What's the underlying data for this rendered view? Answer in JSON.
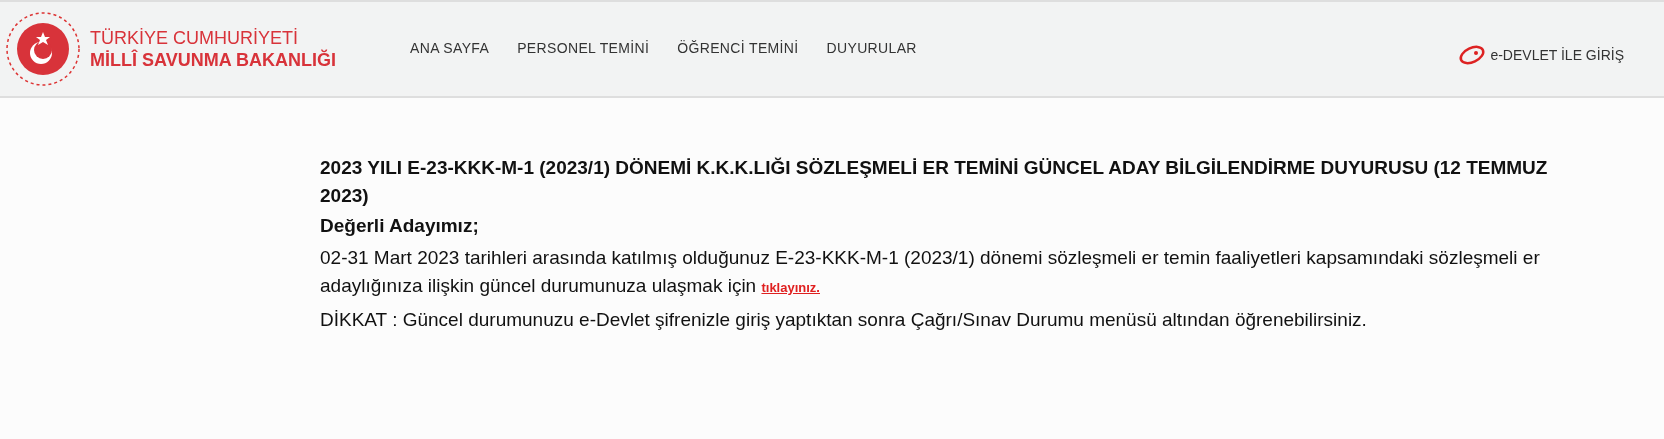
{
  "header": {
    "logo": {
      "line_1": "TÜRKİYE CUMHURİYETİ",
      "line_2": "MİLLÎ SAVUNMA BAKANLIĞI"
    },
    "nav": [
      {
        "label": "ANA SAYFA"
      },
      {
        "label": "PERSONEL TEMİNİ"
      },
      {
        "label": "ÖĞRENCİ TEMİNİ"
      },
      {
        "label": "DUYURULAR"
      }
    ],
    "login": {
      "label": "e-DEVLET İLE GİRİŞ"
    }
  },
  "article": {
    "title": "2023 YILI E-23-KKK-M-1 (2023/1) DÖNEMİ K.K.K.LIĞI SÖZLEŞMELİ ER TEMİNİ GÜNCEL ADAY BİLGİLENDİRME DUYURUSU (12 TEMMUZ 2023)",
    "greeting": "Değerli Adayımız;",
    "body": "02-31 Mart 2023 tarihleri arasında katılmış olduğunuz E-23-KKK-M-1 (2023/1) dönemi sözleşmeli er temin faaliyetleri kapsamındaki sözleşmeli er adaylığınıza ilişkin güncel durumunuza ulaşmak için",
    "link": "tıklayınız.",
    "notice": "DİKKAT : Güncel durumunuzu e-Devlet şifrenizle giriş yaptıktan sonra Çağrı/Sınav Durumu menüsü altından öğrenebilirsiniz."
  }
}
